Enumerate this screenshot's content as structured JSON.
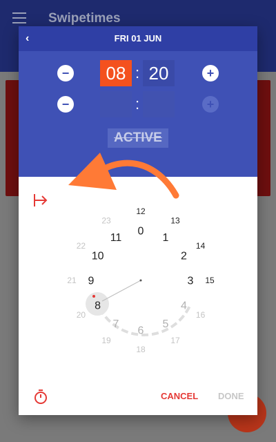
{
  "app": {
    "title": "Swipetimes"
  },
  "dialog": {
    "date": "FRI 01 JUN",
    "start": {
      "hour": "08",
      "minute": "20"
    },
    "end": {
      "hour": "",
      "minute": ""
    },
    "separator": ":",
    "status": "ACTIVE",
    "buttons": {
      "minus": "−",
      "plus": "+",
      "back": "‹"
    },
    "clock": {
      "selected_hour": "8",
      "inner_hours": [
        "0",
        "1",
        "2",
        "3",
        "4",
        "5",
        "6",
        "7",
        "8",
        "9",
        "10",
        "11"
      ],
      "outer_hours": [
        "12",
        "13",
        "14",
        "15",
        "16",
        "17",
        "18",
        "19",
        "20",
        "21",
        "22",
        "23"
      ]
    },
    "actions": {
      "cancel": "CANCEL",
      "done": "DONE"
    }
  },
  "colors": {
    "primary": "#3f51b5",
    "primary_dark": "#2f3fa5",
    "accent": "#f4511e",
    "cancel": "#e53935",
    "done_disabled": "#c7c7c7"
  },
  "icons": [
    "menu-icon",
    "back-icon",
    "minus-icon",
    "plus-icon",
    "exit-icon",
    "timer-icon",
    "swipe-arrow"
  ]
}
